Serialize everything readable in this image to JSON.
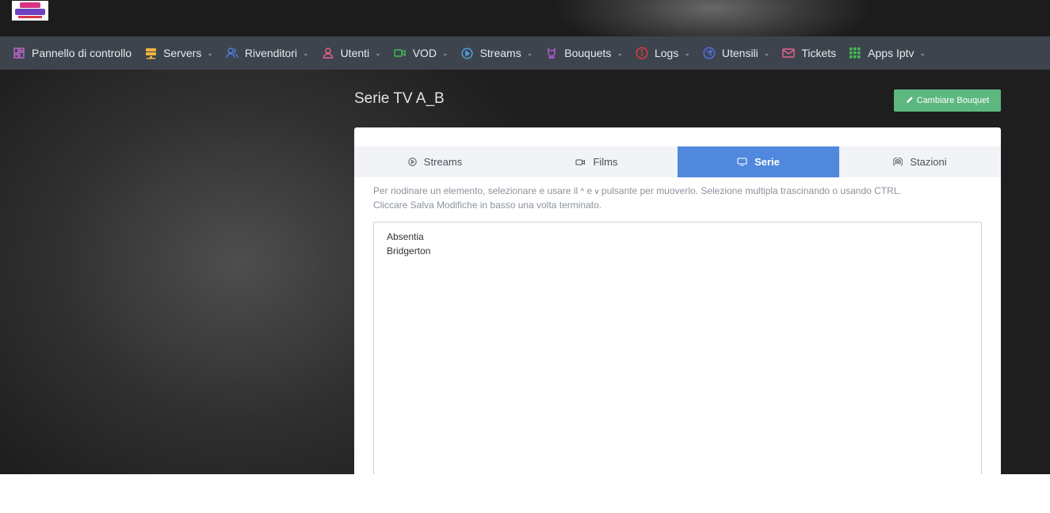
{
  "logo": {
    "alt": "logo"
  },
  "nav": [
    {
      "label": "Pannello di controllo",
      "icon": "dashboard-icon",
      "color": "#c36ad1",
      "dropdown": false
    },
    {
      "label": "Servers",
      "icon": "server-icon",
      "color": "#f0b33c",
      "dropdown": true
    },
    {
      "label": "Rivenditori",
      "icon": "users-icon",
      "color": "#4f7fe0",
      "dropdown": true
    },
    {
      "label": "Utenti",
      "icon": "user-icon",
      "color": "#e8618c",
      "dropdown": true
    },
    {
      "label": "VOD",
      "icon": "video-icon",
      "color": "#3fbf4f",
      "dropdown": true
    },
    {
      "label": "Streams",
      "icon": "play-icon",
      "color": "#4aa3e0",
      "dropdown": true
    },
    {
      "label": "Bouquets",
      "icon": "bouquet-icon",
      "color": "#b15bd8",
      "dropdown": true
    },
    {
      "label": "Logs",
      "icon": "info-icon",
      "color": "#e03a3a",
      "dropdown": true
    },
    {
      "label": "Utensili",
      "icon": "tools-icon",
      "color": "#4f6fe0",
      "dropdown": true
    },
    {
      "label": "Tickets",
      "icon": "mail-icon",
      "color": "#e8618c",
      "dropdown": false
    },
    {
      "label": "Apps Iptv",
      "icon": "grid-icon",
      "color": "#3fbf4f",
      "dropdown": true
    }
  ],
  "page": {
    "title": "Serie TV A_B",
    "change_button": "Cambiare Bouquet"
  },
  "tabs": [
    {
      "label": "Streams",
      "icon": "play-circle-icon",
      "active": false
    },
    {
      "label": "Films",
      "icon": "video-camera-icon",
      "active": false
    },
    {
      "label": "Serie",
      "icon": "monitor-icon",
      "active": true
    },
    {
      "label": "Stazioni",
      "icon": "radio-icon",
      "active": false
    }
  ],
  "help": {
    "part1": "Per riodinare un elemento, selezionare e usare il",
    "up_arrow": "^",
    "conj": "e",
    "down_arrow": "v",
    "part2": "pulsante per muoverlo. Selezione multipla trascinando o usando CTRL.",
    "line2": "Cliccare Salva Modifiche in basso una volta terminato."
  },
  "series_list": [
    "Absentia",
    "Bridgerton"
  ],
  "colors": {
    "navbar_bg": "#3e444e",
    "active_tab": "#4f88dc",
    "change_button": "#5cb87f"
  }
}
